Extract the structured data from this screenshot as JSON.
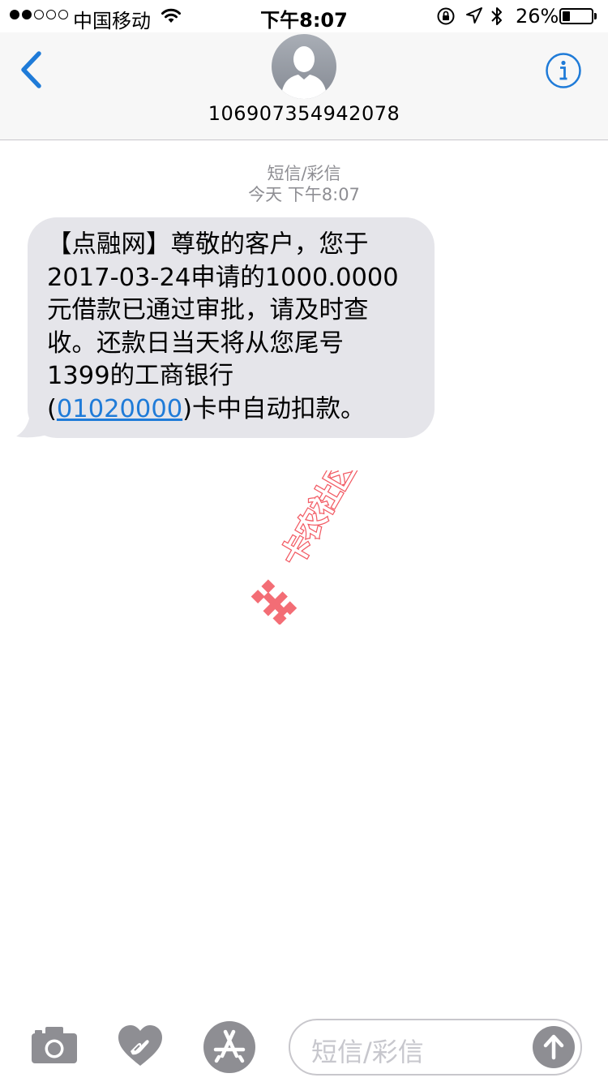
{
  "status_bar": {
    "signal_bars_filled": 2,
    "signal_bars_total": 5,
    "carrier": "中国移动",
    "wifi_icon": "wifi-icon",
    "time": "下午8:07",
    "rotation_lock_icon": "rotation-lock-icon",
    "location_icon": "location-arrow-icon",
    "bluetooth_icon": "bluetooth-icon",
    "battery_percent": "26%",
    "battery_level": 0.26
  },
  "header": {
    "back_icon": "chevron-left-icon",
    "avatar_icon": "person-silhouette-icon",
    "contact": "106907354942078",
    "info_icon": "info-icon"
  },
  "conversation": {
    "type_label": "短信/彩信",
    "timestamp": "今天 下午8:07",
    "message": {
      "lines": [
        "【点融网】尊敬的客户，您于",
        "2017-03-24申请的1000.0000",
        "元借款已通过审批，请及时查",
        "收。还款日当天将从您尾号",
        "1399的工商银行"
      ],
      "last_line_prefix": "(",
      "link_text": "01020000",
      "last_line_suffix": ")卡中自动扣款。"
    }
  },
  "watermark": {
    "text": "卡农社区"
  },
  "input_bar": {
    "camera_icon": "camera-icon",
    "digital_touch_icon": "heart-hands-icon",
    "app_store_icon": "app-store-icon",
    "placeholder": "短信/彩信",
    "send_icon": "arrow-up-icon"
  },
  "colors": {
    "accent": "#1f7bd8",
    "bubble": "#e5e5ea",
    "header_bg": "#f7f7f7",
    "secondary_text": "#8e8e93",
    "watermark_red": "#f25a63"
  }
}
